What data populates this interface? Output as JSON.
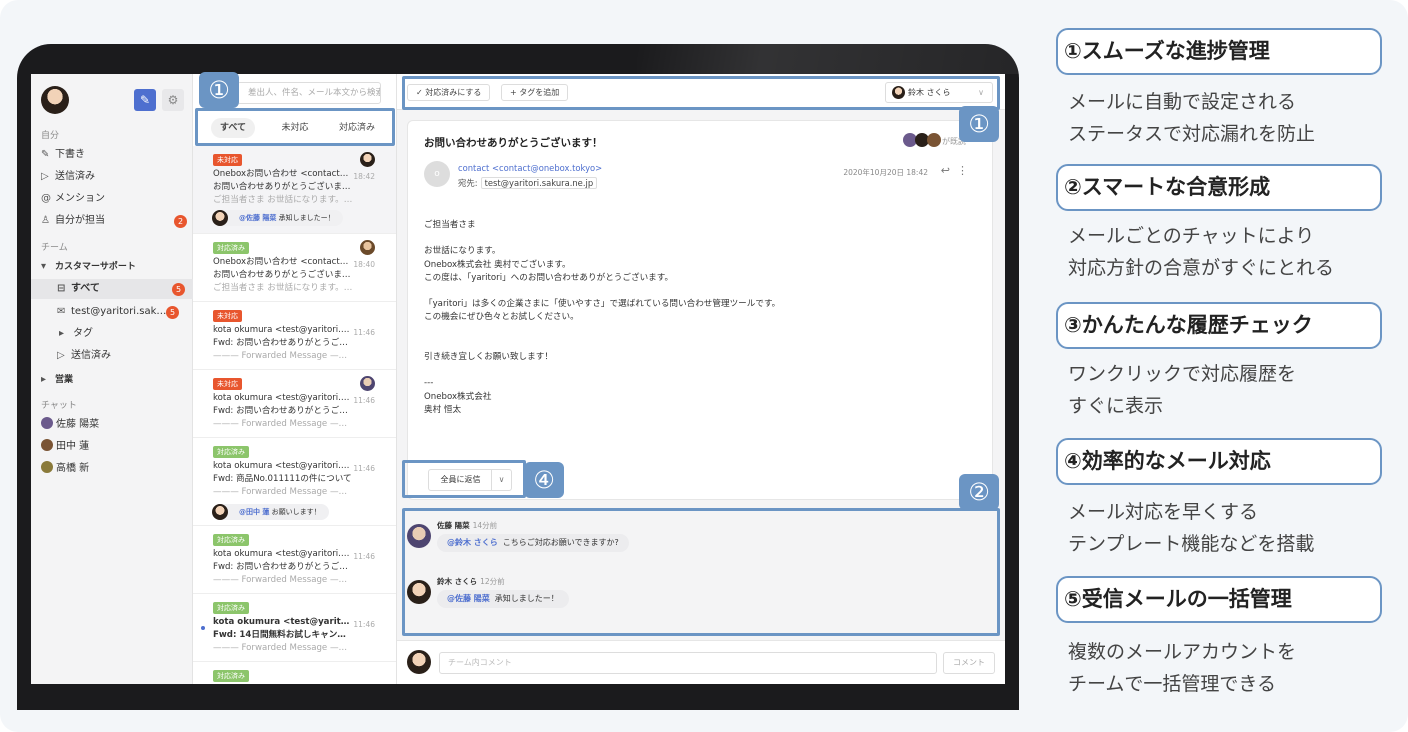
{
  "sidebar": {
    "sections": {
      "self": "自分",
      "team": "チーム",
      "chat": "チャット"
    },
    "items": [
      {
        "icon": "pencil-icon",
        "glyph": "✎",
        "label": "下書き"
      },
      {
        "icon": "send-icon",
        "glyph": "▷",
        "label": "送信済み"
      },
      {
        "icon": "at-icon",
        "glyph": "@",
        "label": "メンション"
      },
      {
        "icon": "person-icon",
        "glyph": "♙",
        "label": "自分が担当",
        "badge": "2"
      }
    ],
    "team": {
      "name": "カスタマーサポート",
      "all": {
        "label": "すべて",
        "badge": "5"
      },
      "account": {
        "label": "test@yaritori.sak…",
        "badge": "5"
      },
      "tag": "タグ",
      "sent": "送信済み",
      "sales": "営業"
    },
    "chats": [
      "佐藤 陽菜",
      "田中 蓮",
      "高橋 新"
    ]
  },
  "maillist": {
    "search_placeholder": "差出人、件名、メール本文から検索",
    "tabs": [
      "すべて",
      "未対応",
      "対応済み"
    ],
    "mails": [
      {
        "tag": "未対応",
        "from": "Oneboxお問い合わせ <contact@…",
        "subject": "お問い合わせありがとうございます！",
        "preview": "ご担当者さま お世話になります。Onebo…",
        "time": "18:42",
        "chat_mention": "@佐藤 陽菜",
        "chat_text": "承知しましたー！"
      },
      {
        "tag": "対応済み",
        "from": "Oneboxお問い合わせ <contact@…",
        "subject": "お問い合わせありがとうございます！",
        "preview": "ご担当者さま お世話になります。Onebo…",
        "time": "18:40"
      },
      {
        "tag": "未対応",
        "from": "kota okumura <test@yaritori.sa…",
        "subject": "Fwd: お問い合わせありがとうございます！",
        "preview": "——— Forwarded Message ———Subj…",
        "time": "11:46"
      },
      {
        "tag": "未対応",
        "from": "kota okumura <test@yaritori.sa…",
        "subject": "Fwd: お問い合わせありがとうございます！",
        "preview": "——— Forwarded Message ———Subj…",
        "time": "11:46"
      },
      {
        "tag": "対応済み",
        "from": "kota okumura <test@yaritori.sa…",
        "subject": "Fwd: 商品No.011111の件について",
        "preview": "——— Forwarded Message ———Subj…",
        "time": "11:46",
        "chat_mention": "@田中 蓮",
        "chat_text": "お願いします！"
      },
      {
        "tag": "対応済み",
        "from": "kota okumura <test@yaritori.sa…",
        "subject": "Fwd: お問い合わせありがとうございます！",
        "preview": "——— Forwarded Message ———Subj…",
        "time": "11:46"
      },
      {
        "tag": "対応済み",
        "from": "kota okumura <test@yaritori.…",
        "subject": "Fwd: 14日間無料お試しキャンペーン実…",
        "preview": "——— Forwarded Message ———Subj…",
        "time": "11:46"
      },
      {
        "tag": "対応済み"
      }
    ]
  },
  "detail": {
    "toolbar": {
      "done_label": "✓ 対応済みにする",
      "tag_label": "+ タグを追加",
      "assignee": "鈴木 さくら"
    },
    "subject": "お問い合わせありがとうございます！",
    "readers_suffix": "が既読",
    "sender_initial": "o",
    "from": "contact <contact@onebox.tokyo>",
    "to_label": "宛先:",
    "to_addr": "test@yaritori.sakura.ne.jp",
    "date": "2020年10月20日 18:42",
    "body": [
      "ご担当者さま",
      "",
      "お世話になります。",
      "Onebox株式会社 奥村でございます。",
      "この度は、「yaritori」へのお問い合わせありがとうございます。",
      "",
      "「yaritori」は多くの企業さまに「使いやすさ」で選ばれている問い合わせ管理ツールです。",
      "この機会にぜひ色々とお試しください。",
      "",
      "",
      "引き続き宜しくお願い致します！",
      "",
      "---",
      "Onebox株式会社",
      "奥村 恒太"
    ],
    "reply_all": "全員に返信",
    "chat": [
      {
        "name": "佐藤 陽菜",
        "ago": "14分前",
        "mention": "@鈴木 さくら",
        "text": "こちらご対応お願いできますか?"
      },
      {
        "name": "鈴木 さくら",
        "ago": "12分前",
        "mention": "@佐藤 陽菜",
        "text": "承知しましたー！"
      }
    ],
    "comment_placeholder": "チーム内コメント",
    "comment_button": "コメント"
  },
  "badges": [
    "①",
    "①",
    "②",
    "④"
  ],
  "features": [
    {
      "title": "①スムーズな進捗管理",
      "desc": [
        "メールに自動で設定される",
        "ステータスで対応漏れを防止"
      ]
    },
    {
      "title": "②スマートな合意形成",
      "desc": [
        "メールごとのチャットにより",
        "対応方針の合意がすぐにとれる"
      ]
    },
    {
      "title": "③かんたんな履歴チェック",
      "desc": [
        "ワンクリックで対応履歴を",
        "すぐに表示"
      ]
    },
    {
      "title": "④効率的なメール対応",
      "desc": [
        "メール対応を早くする",
        "テンプレート機能などを搭載"
      ]
    },
    {
      "title": "⑤受信メールの一括管理",
      "desc": [
        "複数のメールアカウントを",
        "チームで一括管理できる"
      ]
    }
  ],
  "colors": {
    "accent": "#6b95c4",
    "unhandled": "#e8562e",
    "handled": "#8cc56b",
    "mention": "#4e6fcf"
  }
}
